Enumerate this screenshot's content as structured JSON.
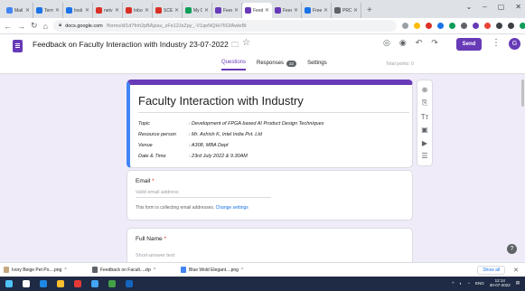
{
  "browser": {
    "tabs": [
      {
        "label": "Mail",
        "color": "#4285f4"
      },
      {
        "label": "Term",
        "color": "#1a73e8"
      },
      {
        "label": "Insti",
        "color": "#1a73e8"
      },
      {
        "label": "netv",
        "color": "#d93025"
      },
      {
        "label": "Inbo",
        "color": "#d93025"
      },
      {
        "label": "SCEC",
        "color": "#d93025"
      },
      {
        "label": "My D",
        "color": "#0f9d58"
      },
      {
        "label": "Feed",
        "color": "#673ab7"
      },
      {
        "label": "Feed",
        "color": "#673ab7",
        "active": true
      },
      {
        "label": "Feed",
        "color": "#673ab7"
      },
      {
        "label": "Free",
        "color": "#1a73e8"
      },
      {
        "label": "PRO",
        "color": "#5f6368"
      }
    ],
    "address": {
      "host": "docs.google.com",
      "path": "/forms/d/1d7fnh2pBAjzau_zFe12JxZpy_-V1qeNQHi76GfAwleBt"
    }
  },
  "header": {
    "doc_title": "Feedback on Faculty Interaction with Industry 23-07-2022",
    "send_label": "Send",
    "avatar_letter": "G",
    "tabs": {
      "questions": "Questions",
      "responses": "Responses",
      "responses_count": "22",
      "settings": "Settings"
    },
    "total_points": "Total points: 0"
  },
  "form": {
    "title": "Faculty Interaction with Industry",
    "info": [
      {
        "key": "Topic",
        "value": ": Development of FPGA based AI Product Design Techniques"
      },
      {
        "key": "Resource person",
        "value": ":   Mr. Ashish K, Intel India Pvt. Ltd"
      },
      {
        "key": "Venue",
        "value": ": A308, MBA Dept"
      },
      {
        "key": "Date & Time",
        "value": ": 23rd July 2022 & 9.30AM"
      }
    ],
    "email": {
      "label": "Email",
      "placeholder": "Valid email address",
      "note": "This form is collecting email addresses.",
      "note_link": "Change settings"
    },
    "name": {
      "label": "Full Name",
      "placeholder": "Short-answer text"
    }
  },
  "downloads": {
    "items": [
      {
        "name": "Ivory Beige Pet Po....png",
        "color": "#c5a880"
      },
      {
        "name": "Feedback on Facult....zip",
        "color": "#5f6368"
      },
      {
        "name": "Blue Wold Elegant....png",
        "color": "#4285f4"
      }
    ],
    "show_all": "Show all"
  },
  "taskbar": {
    "lang": "ENG",
    "time": "12:14",
    "date": "30-07-2022"
  },
  "colors": {
    "accent": "#673ab7",
    "background": "#f0ebf8"
  }
}
